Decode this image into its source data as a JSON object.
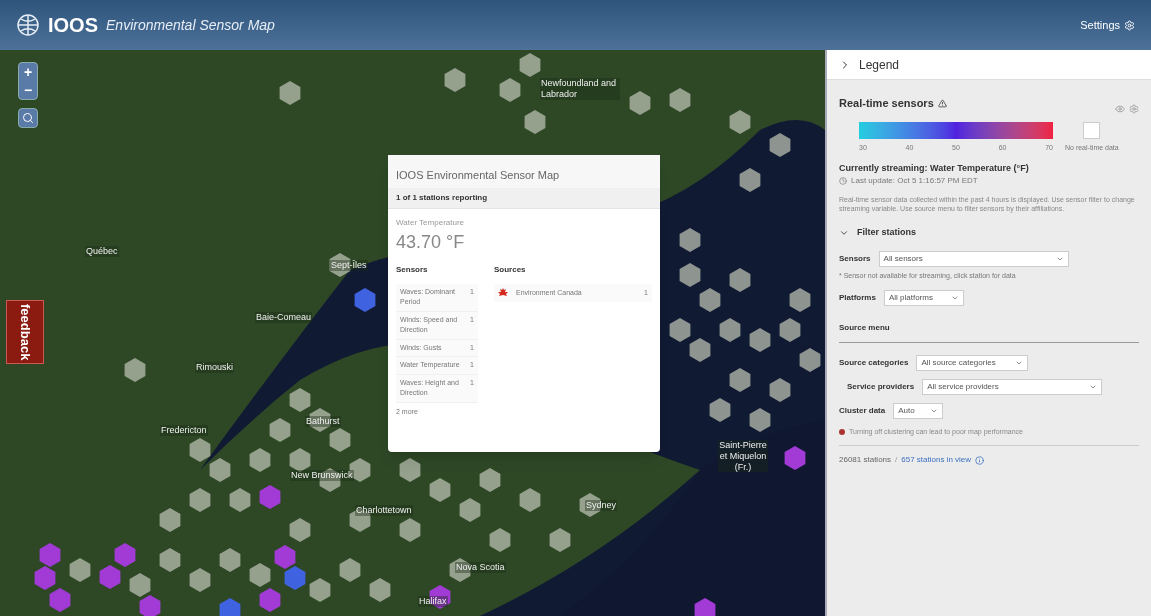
{
  "header": {
    "logo": "IOOS",
    "title": "Environmental Sensor Map",
    "settings": "Settings"
  },
  "map": {
    "zoom_in": "+",
    "zoom_out": "−",
    "feedback": "feedback",
    "labels": [
      "Newfoundland and Labrador",
      "Québec",
      "Sept-Îles",
      "Baie-Comeau",
      "Rimouski",
      "Bathurst",
      "Fredericton",
      "New Brunswick",
      "Charlottetown",
      "Sydney",
      "Nova Scotia",
      "Halifax",
      "Saint-Pierre et Miquelon (Fr.)"
    ]
  },
  "popup": {
    "title": "IOOS Environmental Sensor Map",
    "reporting": "1 of 1 stations reporting",
    "variable": "Water Temperature",
    "reading": "43.70 °F",
    "sensors_heading": "Sensors",
    "sources_heading": "Sources",
    "sensors": [
      {
        "name": "Waves: Dominant Period",
        "count": "1"
      },
      {
        "name": "Winds: Speed and Direction",
        "count": "1"
      },
      {
        "name": "Winds: Gusts",
        "count": "1"
      },
      {
        "name": "Water Temperature",
        "count": "1"
      },
      {
        "name": "Waves: Height and Direction",
        "count": "1"
      }
    ],
    "more": "2 more",
    "sources": [
      {
        "name": "Environment Canada",
        "count": "1"
      }
    ]
  },
  "legend": {
    "title": "Legend",
    "expanded": false,
    "sensors_title": "Real-time sensors",
    "ticks": [
      "30",
      "40",
      "50",
      "60",
      "70"
    ],
    "no_data": "No real-time data",
    "streaming": "Currently streaming: Water Temperature (°F)",
    "last_update": "Last update: Oct 5 1:16:57 PM EDT",
    "description": "Real-time sensor data collected within the past 4 hours is displayed. Use sensor filter to change streaming variable. Use source menu to filter sensors by their affiliations.",
    "filter": {
      "title": "Filter stations",
      "expanded": true,
      "sensors_label": "Sensors",
      "sensors_value": "All sensors",
      "note": "* Sensor not available for streaming, click station for data",
      "platforms_label": "Platforms",
      "platforms_value": "All platforms"
    },
    "source_menu": {
      "title": "Source menu",
      "categories_label": "Source categories",
      "categories_value": "All source categories",
      "providers_label": "Service providers",
      "providers_value": "All service providers",
      "cluster_label": "Cluster data",
      "cluster_value": "Auto",
      "warning": "Turning off clustering can lead to poor map performance"
    },
    "stations": "26081 stations",
    "separator": "/",
    "in_view": "657 stations in view"
  }
}
